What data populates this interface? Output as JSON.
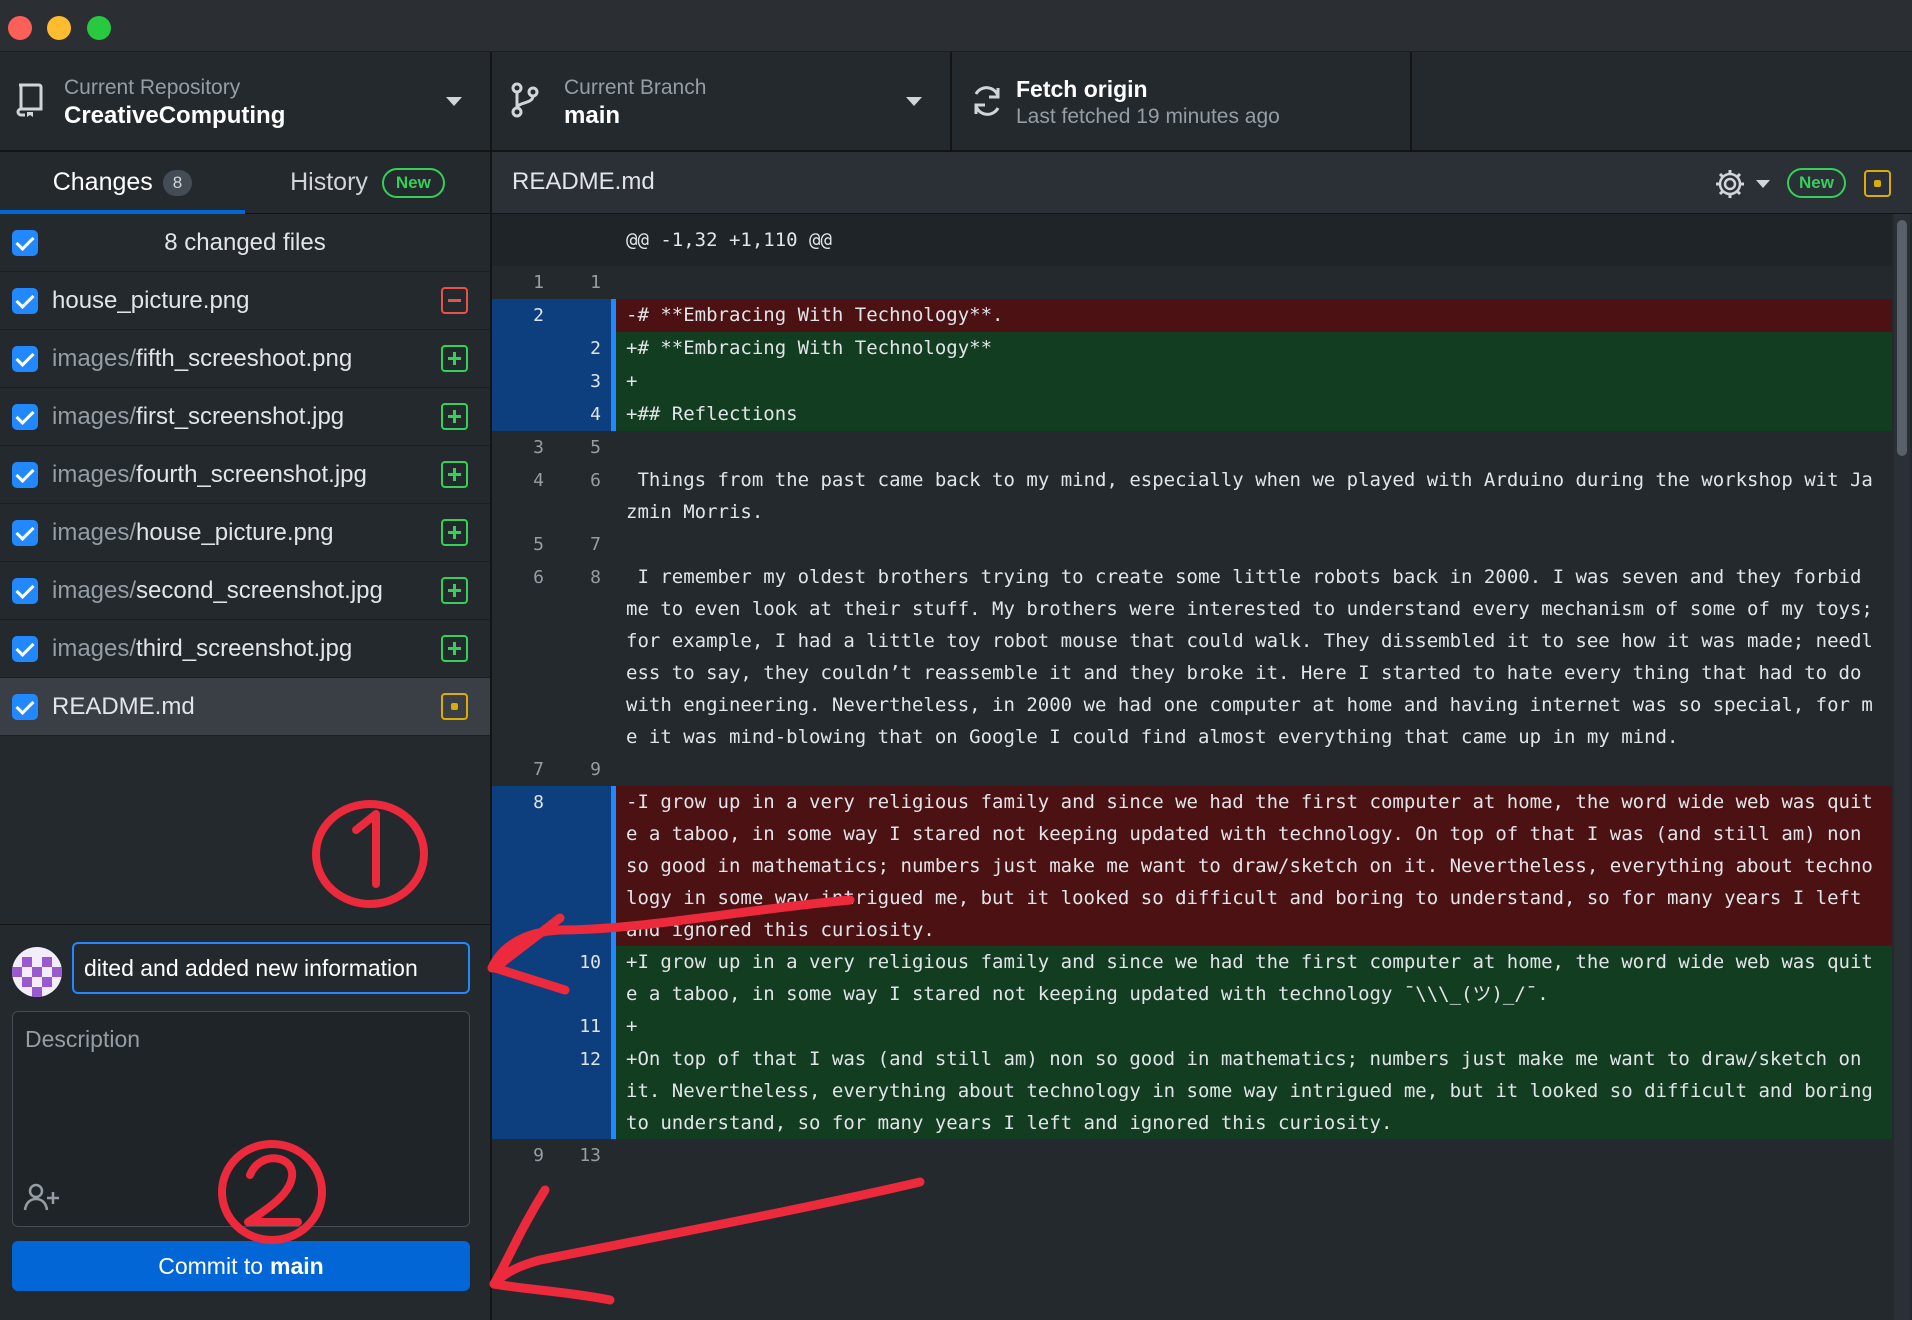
{
  "toolbar": {
    "repo_label": "Current Repository",
    "repo_name": "CreativeComputing",
    "branch_label": "Current Branch",
    "branch_name": "main",
    "fetch_title": "Fetch origin",
    "fetch_sub": "Last fetched 19 minutes ago"
  },
  "tabs": {
    "changes_label": "Changes",
    "changes_count": "8",
    "history_label": "History",
    "history_badge": "New"
  },
  "files": {
    "header": "8 changed files",
    "items": [
      {
        "dir": "",
        "name": "house_picture.png",
        "status": "deleted"
      },
      {
        "dir": "images/",
        "name": "fifth_screeshoot.png",
        "status": "added"
      },
      {
        "dir": "images/",
        "name": "first_screenshot.jpg",
        "status": "added"
      },
      {
        "dir": "images/",
        "name": "fourth_screenshot.jpg",
        "status": "added"
      },
      {
        "dir": "images/",
        "name": "house_picture.png",
        "status": "added"
      },
      {
        "dir": "images/",
        "name": "second_screenshot.jpg",
        "status": "added"
      },
      {
        "dir": "images/",
        "name": "third_screenshot.jpg",
        "status": "added"
      },
      {
        "dir": "",
        "name": "README.md",
        "status": "modified"
      }
    ]
  },
  "commit": {
    "summary_value": "dited and added new information",
    "description_placeholder": "Description",
    "button_prefix": "Commit to",
    "button_branch": "main"
  },
  "diff": {
    "file_title": "README.md",
    "new_badge": "New",
    "hunk_header": "@@ -1,32 +1,110 @@",
    "lines": [
      {
        "type": "ctx",
        "old": "1",
        "new": "1",
        "text": ""
      },
      {
        "type": "del",
        "old": "2",
        "new": "",
        "text": "-# **Embracing With Technology**."
      },
      {
        "type": "add",
        "old": "",
        "new": "2",
        "text": "+# **Embracing With Technology**"
      },
      {
        "type": "add",
        "old": "",
        "new": "3",
        "text": "+"
      },
      {
        "type": "add",
        "old": "",
        "new": "4",
        "text": "+## Reflections"
      },
      {
        "type": "ctx",
        "old": "3",
        "new": "5",
        "text": ""
      },
      {
        "type": "ctx",
        "old": "4",
        "new": "6",
        "text": " Things from the past came back to my mind, especially when we played with Arduino during the workshop wit Jazmin Morris."
      },
      {
        "type": "ctx",
        "old": "5",
        "new": "7",
        "text": ""
      },
      {
        "type": "ctx",
        "old": "6",
        "new": "8",
        "text": " I remember my oldest brothers trying to create some little robots back in 2000. I was seven and they forbid me to even look at their stuff. My brothers were interested to understand every mechanism of some of my toys; for example, I had a little toy robot mouse that could walk. They dissembled it to see how it was made; needless to say, they couldn’t reassemble it and they broke it. Here I started to hate every thing that had to do with engineering. Nevertheless, in 2000 we had one computer at home and having internet was so special, for me it was mind-blowing that on Google I could find almost everything that came up in my mind."
      },
      {
        "type": "ctx",
        "old": "7",
        "new": "9",
        "text": ""
      },
      {
        "type": "del",
        "old": "8",
        "new": "",
        "text": "-I grow up in a very religious family and since we had the first computer at home, the word wide web was quite a taboo, in some way I stared not keeping updated with technology. On top of that I was (and still am) non so good in mathematics; numbers just make me want to draw/sketch on it. Nevertheless, everything about technology in some way intrigued me, but it looked so difficult and boring to understand, so for many years I left and ignored this curiosity."
      },
      {
        "type": "add",
        "old": "",
        "new": "10",
        "text": "+I grow up in a very religious family and since we had the first computer at home, the word wide web was quite a taboo, in some way I stared not keeping updated with technology ¯\\\\\\_(ツ)_/¯."
      },
      {
        "type": "add",
        "old": "",
        "new": "11",
        "text": "+"
      },
      {
        "type": "add",
        "old": "",
        "new": "12",
        "text": "+On top of that I was (and still am) non so good in mathematics; numbers just make me want to draw/sketch on it. Nevertheless, everything about technology in some way intrigued me, but it looked so difficult and boring to understand, so for many years I left and ignored this curiosity."
      },
      {
        "type": "ctx",
        "old": "9",
        "new": "13",
        "text": ""
      }
    ]
  },
  "colors": {
    "accent": "#0366d6",
    "added": "#34d058",
    "deleted": "#e5534b",
    "modified": "#dbab09",
    "annotation": "#ec2a3c"
  },
  "icons": [
    "repo-icon",
    "branch-icon",
    "sync-icon",
    "gear-icon",
    "checkbox-icon",
    "add-coauthor-icon"
  ]
}
